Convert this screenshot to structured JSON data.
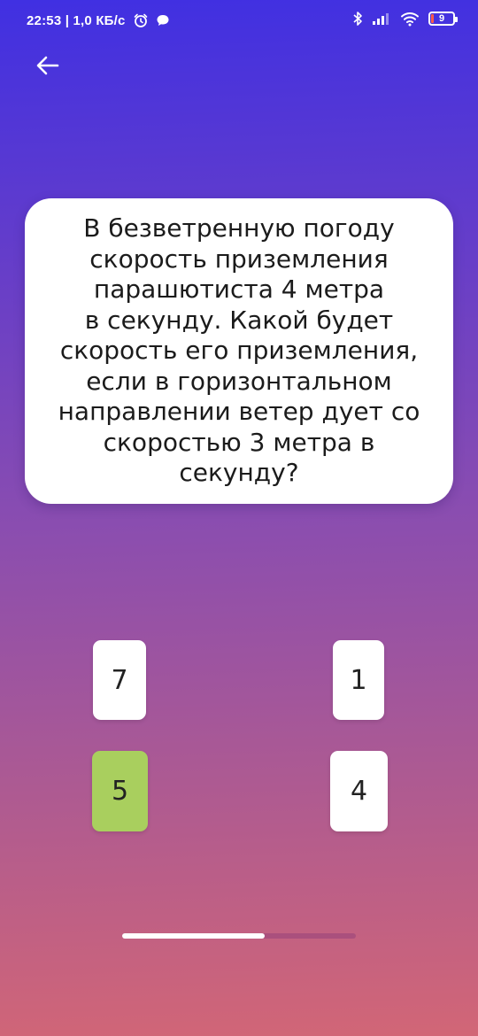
{
  "status_bar": {
    "time_speed": "22:53 | 1,0 КБ/с",
    "battery_level": "9",
    "icons": [
      "alarm-icon",
      "chat-bubble-icon",
      "bluetooth-icon",
      "signal-icon",
      "wifi-icon",
      "battery-icon"
    ]
  },
  "header": {
    "back_icon": "arrow-left-icon"
  },
  "question": {
    "lines": [
      "В безветренную погоду",
      "скорость приземления",
      "парашютиста 4 метра",
      "в секунду. Какой будет",
      "скорость его приземления,",
      "если в горизонтальном",
      "направлении ветер дует со",
      "скоростью 3 метра в секунду?"
    ]
  },
  "answers": [
    {
      "label": "7",
      "state": "default"
    },
    {
      "label": "1",
      "state": "default"
    },
    {
      "label": "5",
      "state": "correct"
    },
    {
      "label": "4",
      "state": "default"
    }
  ],
  "progress": {
    "fraction": 0.61
  },
  "colors": {
    "correct": "#a9cf5e",
    "card": "#ffffff",
    "gradient_top": "#4030e2",
    "gradient_bottom": "#d26676"
  }
}
